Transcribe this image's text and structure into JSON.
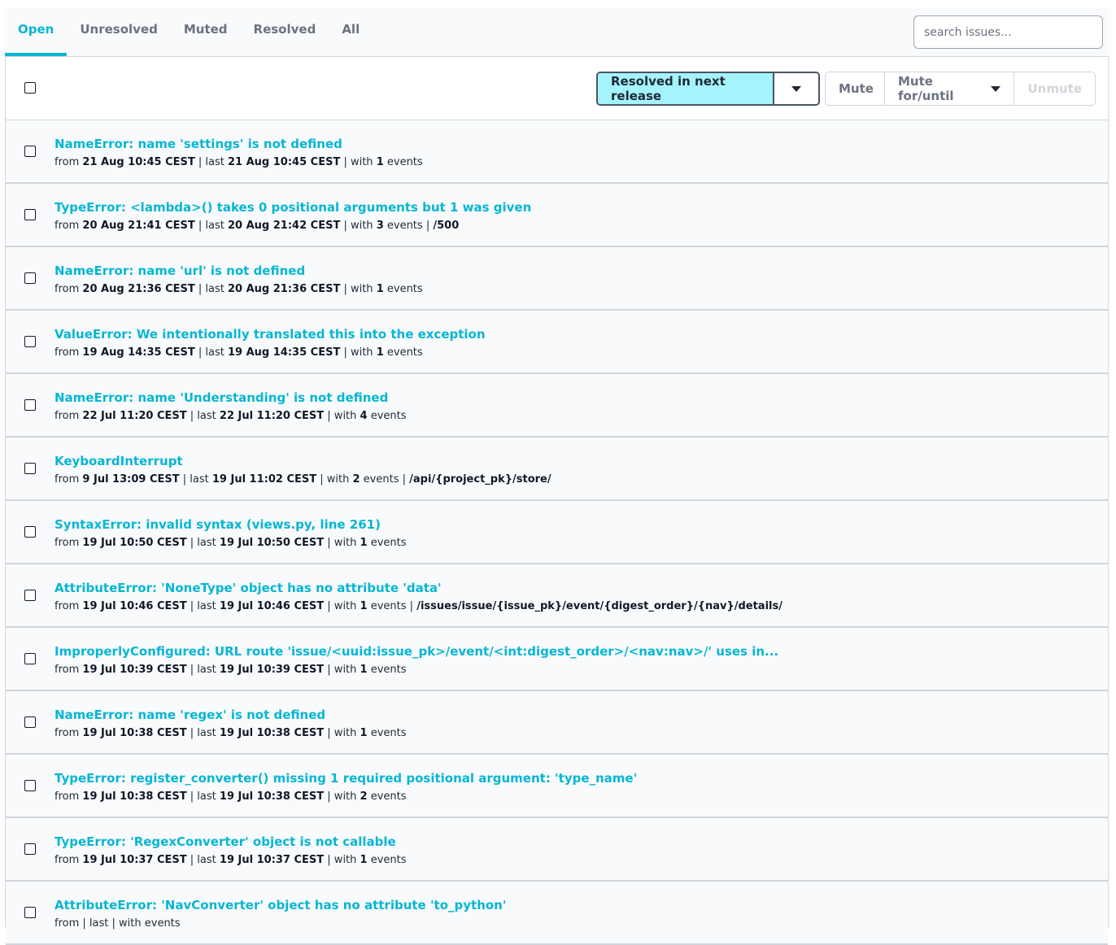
{
  "tabs": [
    {
      "label": "Open",
      "active": true
    },
    {
      "label": "Unresolved",
      "active": false
    },
    {
      "label": "Muted",
      "active": false
    },
    {
      "label": "Resolved",
      "active": false
    },
    {
      "label": "All",
      "active": false
    }
  ],
  "search": {
    "placeholder": "search issues...",
    "value": ""
  },
  "toolbar": {
    "resolve_label": "Resolved in next release",
    "mute_label": "Mute",
    "mute_for_label": "Mute for/until",
    "unmute_label": "Unmute"
  },
  "issues": [
    {
      "title": "NameError: name 'settings' is not defined",
      "first": "21 Aug 10:45 CEST",
      "last": "21 Aug 10:45 CEST",
      "count": "1",
      "path": ""
    },
    {
      "title": "TypeError: <lambda>() takes 0 positional arguments but 1 was given",
      "first": "20 Aug 21:41 CEST",
      "last": "20 Aug 21:42 CEST",
      "count": "3",
      "path": "/500"
    },
    {
      "title": "NameError: name 'url' is not defined",
      "first": "20 Aug 21:36 CEST",
      "last": "20 Aug 21:36 CEST",
      "count": "1",
      "path": ""
    },
    {
      "title": "ValueError: We intentionally translated this into the exception",
      "first": "19 Aug 14:35 CEST",
      "last": "19 Aug 14:35 CEST",
      "count": "1",
      "path": ""
    },
    {
      "title": "NameError: name 'Understanding' is not defined",
      "first": "22 Jul 11:20 CEST",
      "last": "22 Jul 11:20 CEST",
      "count": "4",
      "path": ""
    },
    {
      "title": "KeyboardInterrupt",
      "first": "9 Jul 13:09 CEST",
      "last": "19 Jul 11:02 CEST",
      "count": "2",
      "path": "/api/{project_pk}/store/"
    },
    {
      "title": "SyntaxError: invalid syntax (views.py, line 261)",
      "first": "19 Jul 10:50 CEST",
      "last": "19 Jul 10:50 CEST",
      "count": "1",
      "path": ""
    },
    {
      "title": "AttributeError: 'NoneType' object has no attribute 'data'",
      "first": "19 Jul 10:46 CEST",
      "last": "19 Jul 10:46 CEST",
      "count": "1",
      "path": "/issues/issue/{issue_pk}/event/{digest_order}/{nav}/details/"
    },
    {
      "title": "ImproperlyConfigured: URL route 'issue/<uuid:issue_pk>/event/<int:digest_order>/<nav:nav>/' uses in...",
      "first": "19 Jul 10:39 CEST",
      "last": "19 Jul 10:39 CEST",
      "count": "1",
      "path": ""
    },
    {
      "title": "NameError: name 'regex' is not defined",
      "first": "19 Jul 10:38 CEST",
      "last": "19 Jul 10:38 CEST",
      "count": "1",
      "path": ""
    },
    {
      "title": "TypeError: register_converter() missing 1 required positional argument: 'type_name'",
      "first": "19 Jul 10:38 CEST",
      "last": "19 Jul 10:38 CEST",
      "count": "2",
      "path": ""
    },
    {
      "title": "TypeError: 'RegexConverter' object is not callable",
      "first": "19 Jul 10:37 CEST",
      "last": "19 Jul 10:37 CEST",
      "count": "1",
      "path": ""
    },
    {
      "title": "AttributeError: 'NavConverter' object has no attribute 'to_python'",
      "first": "",
      "last": "",
      "count": "",
      "path": ""
    }
  ],
  "labels": {
    "from": "from",
    "last": "| last",
    "with": "| with",
    "events": "events",
    "sep": "|"
  },
  "colors": {
    "accent": "#06b6d4",
    "resolve_bg": "#a5f3fc",
    "row_bg": "#f9fafb"
  }
}
